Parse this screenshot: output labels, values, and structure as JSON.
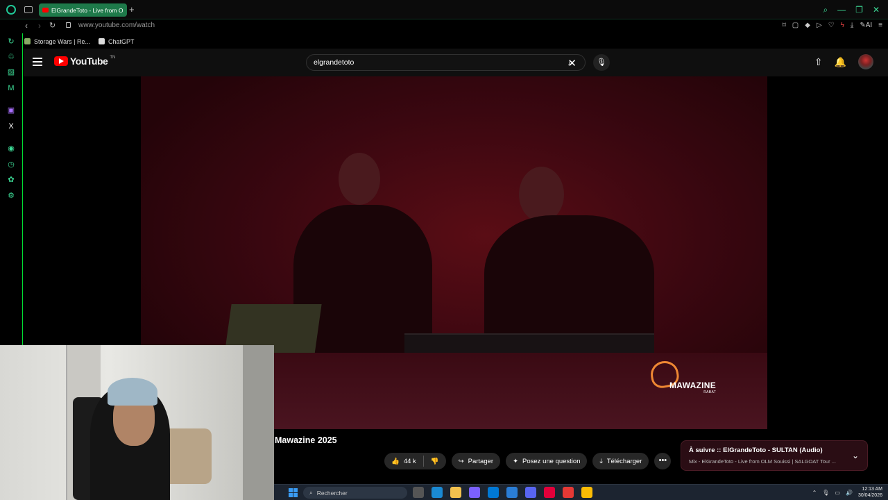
{
  "browser": {
    "tab_title": "ElGrandeToto - Live from O",
    "url": "www.youtube.com/watch",
    "bookmarks": [
      {
        "label": "Storage Wars | Re..."
      },
      {
        "label": "ChatGPT"
      }
    ]
  },
  "youtube": {
    "logo_text": "YouTube",
    "logo_region": "TN",
    "search_value": "elgrandetoto"
  },
  "video": {
    "watermark": "MAWAZINE",
    "watermark_sub": "RABAT",
    "title": "Mawazine 2025",
    "likes": "44 k",
    "share_label": "Partager",
    "ask_label": "Posez une question",
    "download_label": "Télécharger"
  },
  "up_next": {
    "heading": "À suivre :: ElGrandeToto - SULTAN (Audio)",
    "sub": "Mix - ElGrandeToto - Live from OLM Souissi | SALGOAT Tour ..."
  },
  "taskbar": {
    "search_placeholder": "Rechercher",
    "time": "12:13 AM",
    "date": "30/04/2026"
  },
  "colors": {
    "accent_green": "#3ddc97",
    "youtube_red": "#ff0000",
    "video_tint": "#3a0710"
  }
}
